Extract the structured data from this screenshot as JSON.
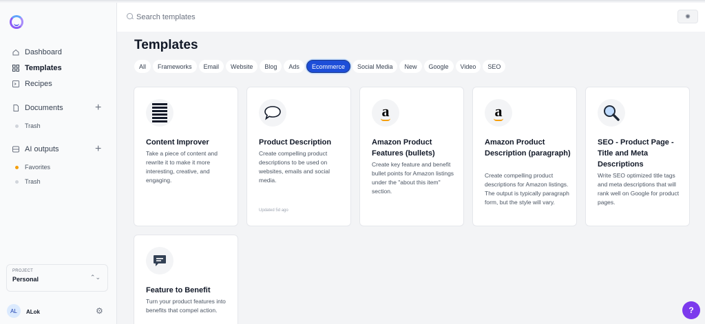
{
  "search": {
    "placeholder": "Search templates"
  },
  "sidebar": {
    "nav": [
      {
        "label": "Dashboard"
      },
      {
        "label": "Templates"
      },
      {
        "label": "Recipes"
      }
    ],
    "documents": {
      "label": "Documents",
      "items": [
        {
          "label": "Trash"
        }
      ]
    },
    "ai_outputs": {
      "label": "AI outputs",
      "items": [
        {
          "label": "Favorites"
        },
        {
          "label": "Trash"
        }
      ]
    },
    "project": {
      "label": "PROJECT",
      "value": "Personal"
    },
    "user": {
      "initials": "AL",
      "name": "ALok"
    }
  },
  "main": {
    "title": "Templates",
    "tabs": [
      {
        "label": "All"
      },
      {
        "label": "Frameworks"
      },
      {
        "label": "Email"
      },
      {
        "label": "Website"
      },
      {
        "label": "Blog"
      },
      {
        "label": "Ads"
      },
      {
        "label": "Ecommerce"
      },
      {
        "label": "Social Media"
      },
      {
        "label": "New"
      },
      {
        "label": "Google"
      },
      {
        "label": "Video"
      },
      {
        "label": "SEO"
      }
    ],
    "active_tab": "Ecommerce",
    "cards": [
      {
        "title": "Content Improver",
        "description": "Take a piece of content and rewrite it to make it more interesting, creative, and engaging.",
        "icon": "stacked-lines-icon"
      },
      {
        "title": "Product Description",
        "description": "Create compelling product descriptions to be used on websites, emails and social media.",
        "updated": "Updated 5d ago",
        "icon": "speech-bubble-icon"
      },
      {
        "title": "Amazon Product Features (bullets)",
        "description": "Create key feature and benefit bullet points for Amazon listings under the \"about this item\" section.",
        "icon": "amazon-icon"
      },
      {
        "title": "Amazon Product Description (paragraph)",
        "description": "Create compelling product descriptions for Amazon listings. The output is typically paragraph form, but the style will vary.",
        "icon": "amazon-icon"
      },
      {
        "title": "SEO - Product Page - Title and Meta Descriptions",
        "description": "Write SEO optimized title tags and meta descriptions that will rank well on Google for product pages.",
        "icon": "magnifier-icon"
      },
      {
        "title": "Feature to Benefit",
        "description": "Turn your product features into benefits that compel action.",
        "icon": "message-icon"
      }
    ]
  },
  "help": {
    "label": "?"
  },
  "colors": {
    "accent": "#1d4ed8",
    "help": "#7c3aed",
    "brand": "#8b5cf6"
  }
}
